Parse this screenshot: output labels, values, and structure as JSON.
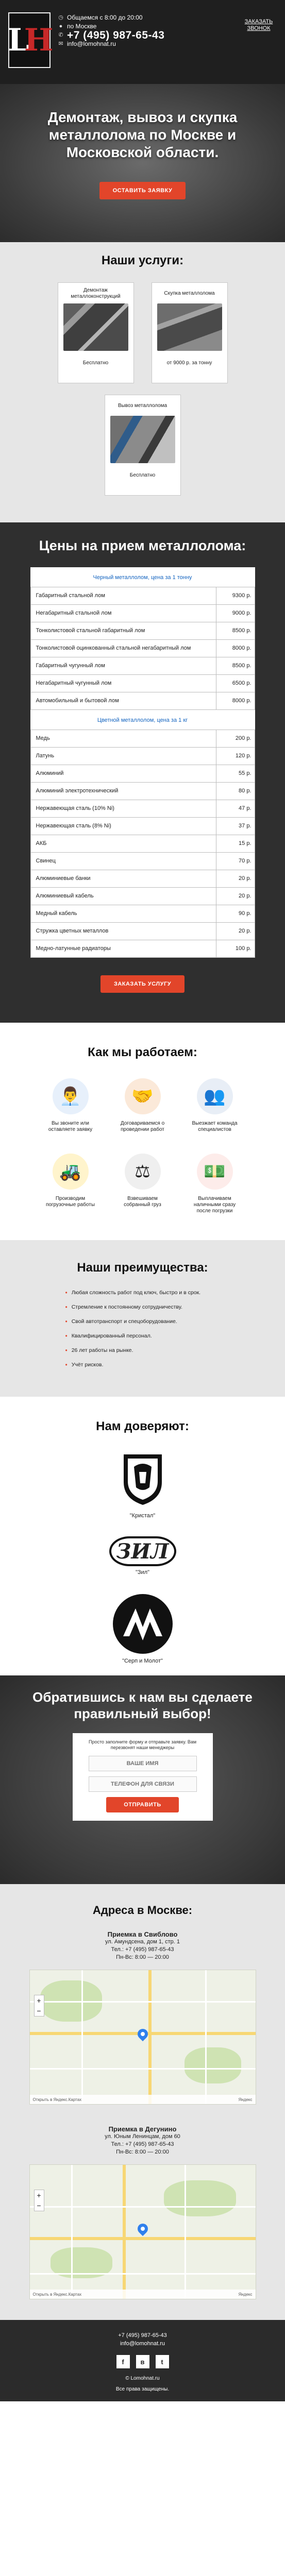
{
  "header": {
    "logo_text_left": "L",
    "logo_text_right": "H",
    "hours": "Общаемся с 8:00 до 20:00",
    "city": "по Москве",
    "phone": "+7 (495) 987-65-43",
    "email": "info@lomohnat.ru",
    "order_link": "ЗАКАЗАТЬ ЗВОНОК"
  },
  "hero": {
    "title": "Демонтаж, вывоз и скупка металлолома по Москве и Московской области.",
    "cta": "ОСТАВИТЬ ЗАЯВКУ"
  },
  "services": {
    "title": "Наши услуги:",
    "items": [
      {
        "title": "Демонтаж металлоконструкций",
        "note": "Бесплатно"
      },
      {
        "title": "Скупка металлолома",
        "note": "от 9000 р. за тонну"
      },
      {
        "title": "Вывоз металлолома",
        "note": "Бесплатно"
      }
    ]
  },
  "prices": {
    "title": "Цены на прием металлолома:",
    "ferrous_caption": "Черный металлолом, цена за 1 тонну",
    "ferrous": [
      {
        "name": "Габаритный стальной лом",
        "price": "9300 р."
      },
      {
        "name": "Негабаритный стальной лом",
        "price": "9000 р."
      },
      {
        "name": "Тонколистовой стальной габаритный лом",
        "price": "8500 р."
      },
      {
        "name": "Тонколистовой оцинкованный стальной негабаритный лом",
        "price": "8000 р."
      },
      {
        "name": "Габаритный чугунный лом",
        "price": "8500 р."
      },
      {
        "name": "Негабаритный чугунный лом",
        "price": "6500 р."
      },
      {
        "name": "Автомобильный и бытовой лом",
        "price": "8000 р."
      }
    ],
    "nonferrous_caption": "Цветной металлолом, цена за 1 кг",
    "nonferrous": [
      {
        "name": "Медь",
        "price": "200 р."
      },
      {
        "name": "Латунь",
        "price": "120 р."
      },
      {
        "name": "Алюминий",
        "price": "55 р."
      },
      {
        "name": "Алюминий электротехнический",
        "price": "80 р."
      },
      {
        "name": "Нержавеющая сталь (10% Ni)",
        "price": "47 р."
      },
      {
        "name": "Нержавеющая сталь (8% Ni)",
        "price": "37 р."
      },
      {
        "name": "АКБ",
        "price": "15 р."
      },
      {
        "name": "Свинец",
        "price": "70 р."
      },
      {
        "name": "Алюминиевые банки",
        "price": "20 р."
      },
      {
        "name": "Алюминиевый кабель",
        "price": "20 р."
      },
      {
        "name": "Медный кабель",
        "price": "90 р."
      },
      {
        "name": "Стружка цветных металлов",
        "price": "20 р."
      },
      {
        "name": "Медно-латунные радиаторы",
        "price": "100 р."
      }
    ],
    "cta": "ЗАКАЗАТЬ УСЛУГУ"
  },
  "how": {
    "title": "Как мы работаем:",
    "steps": [
      {
        "icon": "manager-icon",
        "glyph": "👨‍💼",
        "text": "Вы звоните или оставляете заявку"
      },
      {
        "icon": "handshake-icon",
        "glyph": "🤝",
        "text": "Договариваемся о проведении работ"
      },
      {
        "icon": "team-icon",
        "glyph": "👥",
        "text": "Выезжает команда специалистов"
      },
      {
        "icon": "forklift-icon",
        "glyph": "🚜",
        "text": "Производим погрузочные работы"
      },
      {
        "icon": "scale-icon",
        "glyph": "⚖",
        "text": "Взвешиваем собранный груз"
      },
      {
        "icon": "money-icon",
        "glyph": "💵",
        "text": "Выплачиваем наличными сразу после погрузки"
      }
    ]
  },
  "advantages": {
    "title": "Наши преимущества:",
    "items": [
      "Любая сложность работ под ключ, быстро и в срок.",
      "Стремление к постоянному сотрудничеству.",
      "Свой автотранспорт и спецоборудование.",
      "Квалифицированный персонал.",
      "26 лет работы на рынке.",
      "Учёт рисков."
    ]
  },
  "trust": {
    "title": "Нам доверяют:",
    "clients": [
      "\"Кристал\"",
      "\"Зил\"",
      "\"Серп и Молот\""
    ],
    "zil_mark": "ЗИЛ"
  },
  "callback": {
    "title": "Обратившись к нам вы сделаете правильный выбор!",
    "lead": "Просто заполните форму и отправьте заявку. Вам перезвонят наши менеджеры",
    "name_placeholder": "ВАШЕ ИМЯ",
    "phone_placeholder": "ТЕЛЕФОН ДЛЯ СВЯЗИ",
    "submit": "ОТПРАВИТЬ"
  },
  "addresses": {
    "title": "Адреса в Москве:",
    "offices": [
      {
        "name": "Приемка в Свиблово",
        "lines": [
          "ул. Амундсена, дом 1, стр. 1",
          "Тел.: +7 (495) 987-65-43",
          "Пн-Вс: 8:00 — 20:00"
        ]
      },
      {
        "name": "Приемка в Дегунино",
        "lines": [
          "ул. Юным Ленинцам, дом 60",
          "Тел.: +7 (495) 987-65-43",
          "Пн-Вс: 8:00 — 20:00"
        ]
      }
    ],
    "map_footer_left": "Открыть в Яндекс.Картах",
    "map_footer_right": "Яндекс"
  },
  "footer": {
    "phone": "+7 (495) 987-65-43",
    "email": "info@lomohnat.ru",
    "social": [
      "f",
      "в",
      "t"
    ],
    "copyright": "© Lomohnat.ru",
    "rights": "Все права защищены."
  }
}
